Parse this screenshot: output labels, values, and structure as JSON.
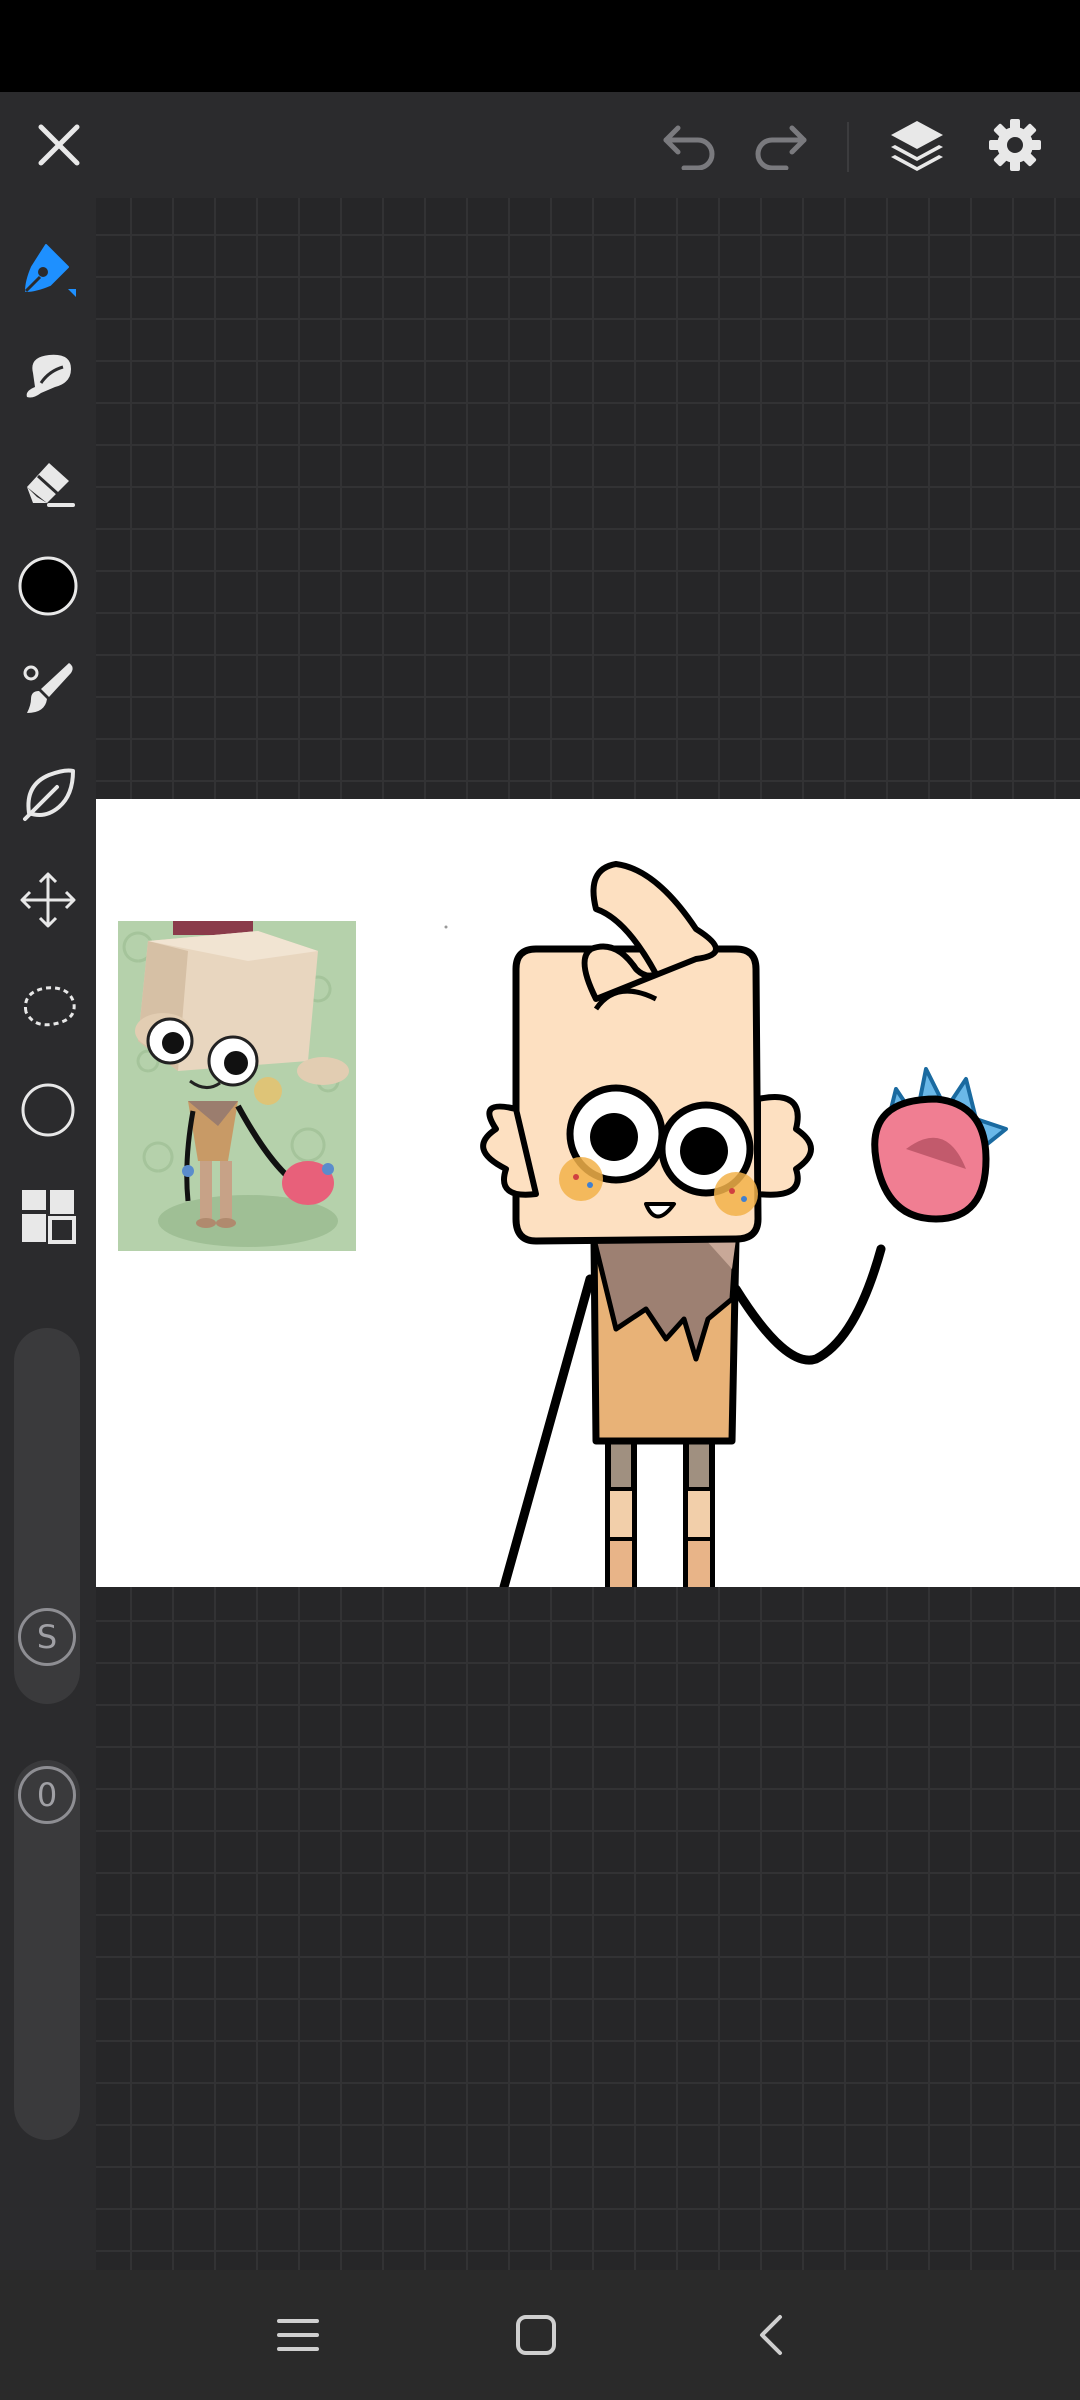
{
  "app": {
    "accent": "#1e90ff",
    "current_color": "#000000",
    "icons": {
      "close": "close-icon",
      "undo": "undo-icon",
      "redo": "redo-icon",
      "layers": "layers-icon",
      "settings": "gear-icon",
      "brush": "pen-tool-icon",
      "smudge": "smudge-icon",
      "eraser": "eraser-icon",
      "color": "color-swatch-icon",
      "brush_settings": "paintbrush-icon",
      "fill": "leaf-icon",
      "transform": "move-icon",
      "lasso": "lasso-icon",
      "shape": "circle-icon",
      "gallery": "grid-icon"
    }
  },
  "sliders": {
    "size_badge": "S",
    "opacity_badge": "0"
  },
  "nav": {
    "menu": "recent-apps-icon",
    "home": "home-icon",
    "back": "back-icon"
  }
}
